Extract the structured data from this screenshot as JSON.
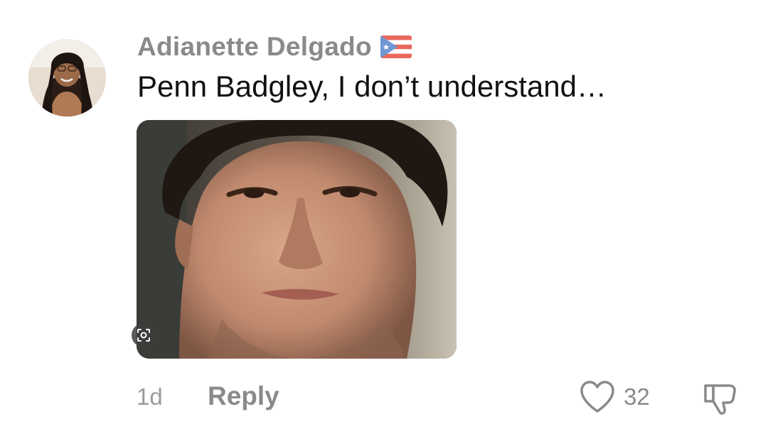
{
  "comment": {
    "username": "Adianette Delgado",
    "flag_icon": "puerto-rico-flag-icon",
    "text": "Penn Badgley, I don’t understand…",
    "attachment_icon": "visual-search-icon",
    "timestamp": "1d",
    "reply_label": "Reply",
    "like_icon": "heart-icon",
    "like_count": "32",
    "dislike_icon": "thumbs-down-icon"
  },
  "colors": {
    "username": "#8a8a8a",
    "text": "#111111",
    "meta": "#9a9a9a"
  }
}
